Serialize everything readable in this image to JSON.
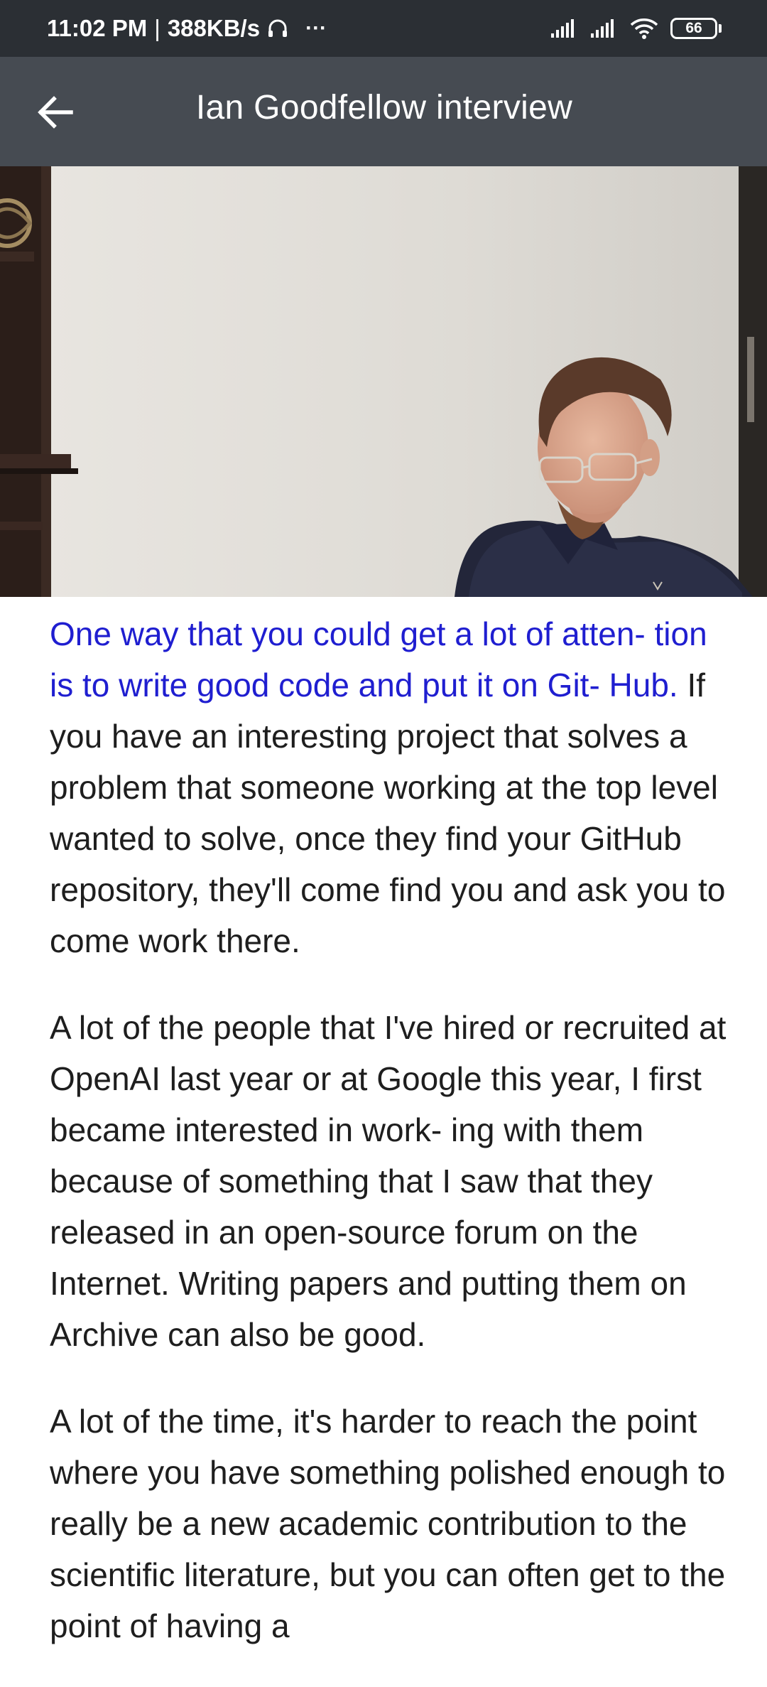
{
  "status_bar": {
    "time": "11:02 PM",
    "separator": "|",
    "network_speed": "388KB/s",
    "more": "···",
    "battery_level": "66",
    "icons": [
      "headphones-icon",
      "signal-icon",
      "signal-icon",
      "wifi-icon",
      "battery-icon"
    ]
  },
  "app_bar": {
    "title": "Ian Goodfellow interview",
    "back_icon": "arrow-left-icon"
  },
  "article": {
    "paragraph_1_highlight": "One way that you could get a lot of atten- tion is to write good code and put it on Git- Hub.",
    "paragraph_1_rest": " If you have an interesting project that solves a problem that someone working at the top level wanted to solve, once they find your GitHub repository, they'll come find you and ask you to come work there.",
    "paragraph_2": "A lot of the people that I've hired or recruited at OpenAI last year or at Google this year, I first became interested in work- ing with them because of something that I saw that they released in an open-source forum on the Internet. Writing papers and putting them on Archive can also be good.",
    "paragraph_3": "A lot of the time, it's harder to reach the point where you have something polished enough to really be a new academic contribution to the scientific literature, but you can often get to the point of having a"
  },
  "colors": {
    "status_bar_bg": "#2b2f34",
    "app_bar_bg": "#464b52",
    "highlight_text": "#1f1ed0",
    "body_text": "#1e1e1e"
  }
}
